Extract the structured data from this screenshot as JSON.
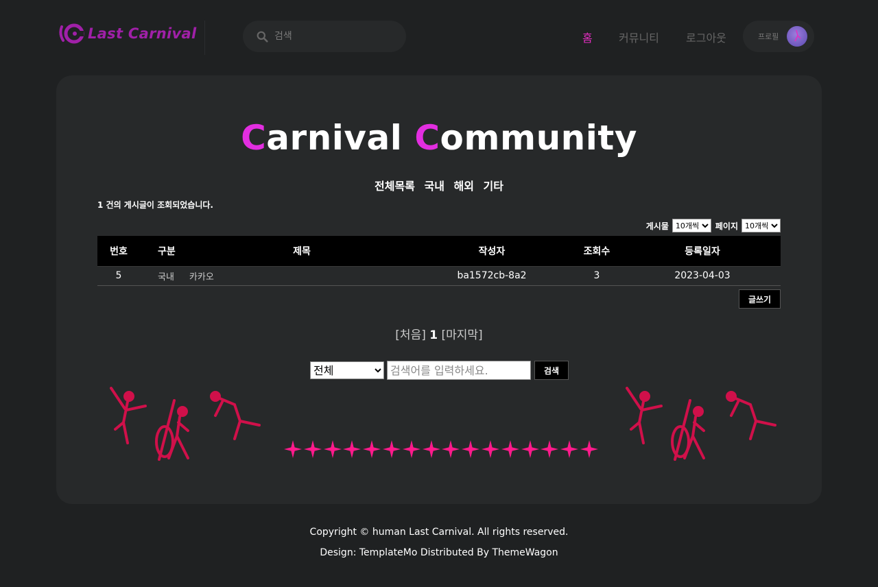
{
  "header": {
    "logo_text": "Last Carnival",
    "search_placeholder": "검색",
    "nav": [
      {
        "label": "홈",
        "active": true
      },
      {
        "label": "커뮤니티",
        "active": false
      },
      {
        "label": "로그아웃",
        "active": false
      }
    ],
    "profile_label": "프로필"
  },
  "main": {
    "title_first_letter": "C",
    "title_first_rest": "arnival",
    "title_second_letter": "C",
    "title_second_rest": "ommunity",
    "categories": [
      "전체목록",
      "국내",
      "해외",
      "기타"
    ],
    "result_count": "1 건의 게시글이 조회되었습니다.",
    "per_page_label": "게시물",
    "per_page_value": "10개씩",
    "page_label": "페이지",
    "page_value": "10개씩",
    "table": {
      "headers": [
        "번호",
        "구분",
        "제목",
        "작성자",
        "조회수",
        "등록일자"
      ],
      "rows": [
        {
          "no": "5",
          "category": "국내",
          "subcategory": "카카오",
          "title": "",
          "author": "ba1572cb-8a2",
          "views": "3",
          "date": "2023-04-03"
        }
      ]
    },
    "write_button": "글쓰기",
    "pagination": {
      "first": "[처음]",
      "current": "1",
      "last": "[마지막]"
    },
    "search": {
      "scope_value": "전체",
      "placeholder": "검색어를 입력하세요.",
      "button": "검색"
    }
  },
  "footer": {
    "copyright": "Copyright © human Last Carnival. All rights reserved.",
    "design": "Design: TemplateMo Distributed By ThemeWagon"
  },
  "colors": {
    "background": "#1f2122",
    "panel": "#27292a",
    "accent": "#e22ec0",
    "logo": "#a020a8",
    "stars": "#ff1a8c",
    "dancers": "#d0104a"
  }
}
